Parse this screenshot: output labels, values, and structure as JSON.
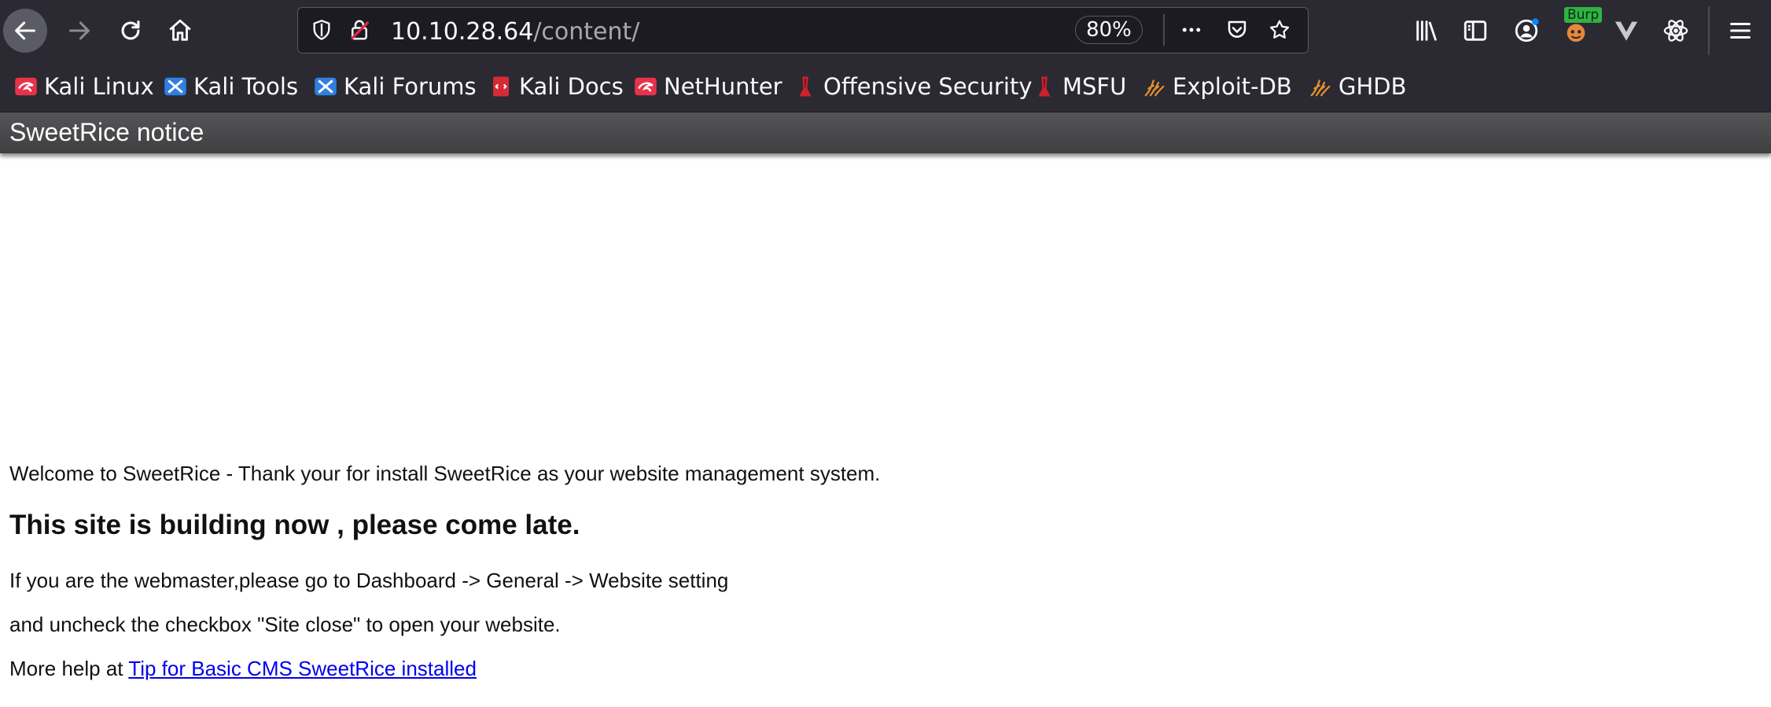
{
  "toolbar": {
    "url_host": "10.10.28.64",
    "url_path": "/content/",
    "zoom": "80%",
    "burp_badge": "Burp"
  },
  "bookmarks": [
    {
      "label": "Kali Linux",
      "icon": "kali-dragon-icon"
    },
    {
      "label": "Kali Tools",
      "icon": "kali-tools-icon"
    },
    {
      "label": "Kali Forums",
      "icon": "kali-forums-icon"
    },
    {
      "label": "Kali Docs",
      "icon": "kali-docs-icon"
    },
    {
      "label": "NetHunter",
      "icon": "kali-dragon-icon"
    },
    {
      "label": "Offensive Security",
      "icon": "offsec-icon"
    },
    {
      "label": "MSFU",
      "icon": "offsec-icon"
    },
    {
      "label": "Exploit-DB",
      "icon": "exploit-db-icon"
    },
    {
      "label": "GHDB",
      "icon": "exploit-db-icon"
    }
  ],
  "page": {
    "header_title": "SweetRice notice",
    "welcome": "Welcome to SweetRice - Thank your for install SweetRice as your website management system.",
    "heading": "This site is building now , please come late.",
    "line1": "If you are the webmaster,please go to Dashboard -> General -> Website setting",
    "line2": "and uncheck the checkbox \"Site close\" to open your website.",
    "line3_prefix": "More help at",
    "help_link": "Tip for Basic CMS SweetRice installed"
  },
  "colors": {
    "toolbar_bg": "#2b2a33",
    "urlbar_bg": "#1c1b22",
    "header_bg": "#4a4a4d",
    "link": "#0000ee"
  }
}
